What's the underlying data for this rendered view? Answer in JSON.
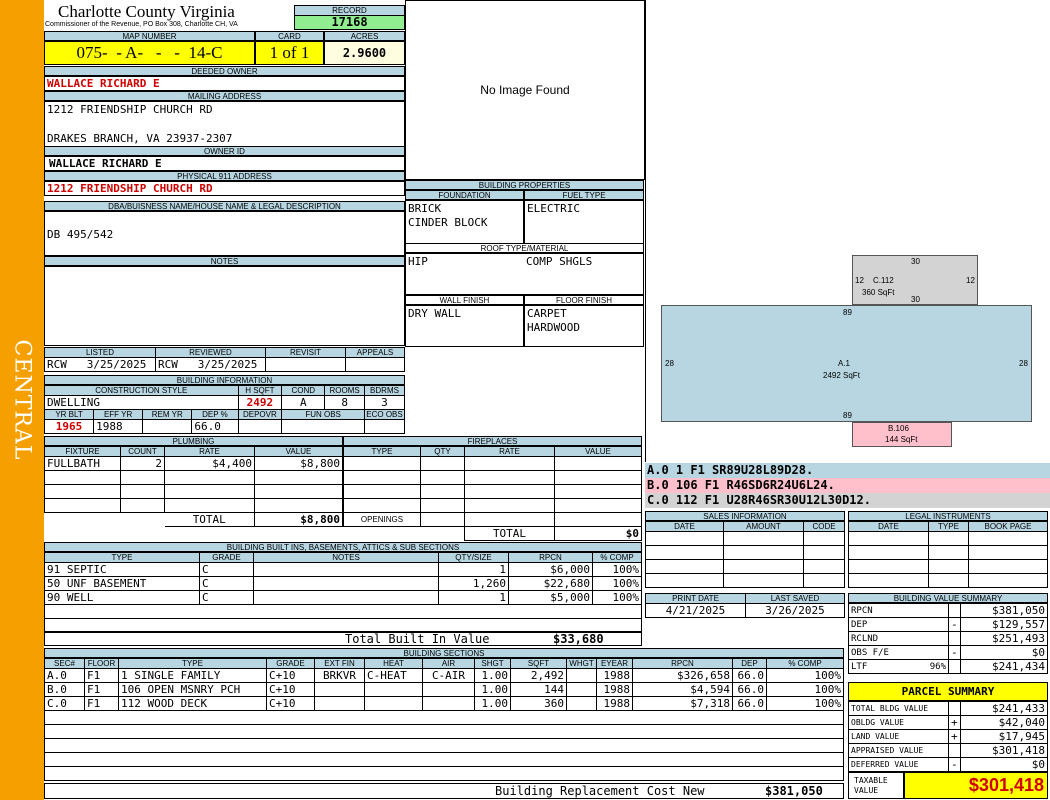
{
  "region": "CENTRAL",
  "county": {
    "title": "Charlotte County Virginia",
    "subtitle": "Commissioner of the Revenue, PO Box 308, Charlotte CH, VA"
  },
  "record": {
    "label": "RECORD",
    "value": "17168"
  },
  "map": {
    "label": "MAP NUMBER",
    "value": "075-  - A-   -   -  14-C"
  },
  "card": {
    "label": "CARD",
    "value": "1 of 1"
  },
  "acres": {
    "label": "ACRES",
    "value": "2.9600"
  },
  "deeded_owner": {
    "label": "DEEDED OWNER",
    "value": "WALLACE RICHARD E"
  },
  "mailing": {
    "label": "MAILING ADDRESS",
    "line1": "1212 FRIENDSHIP CHURCH RD",
    "line2": "DRAKES BRANCH, VA 23937-2307"
  },
  "owner_id": {
    "label": "OWNER ID",
    "value": "WALLACE RICHARD E"
  },
  "physical": {
    "label": "PHYSICAL 911 ADDRESS",
    "value": "1212 FRIENDSHIP CHURCH RD"
  },
  "dba": {
    "label": "DBA/BUISNESS NAME/HOUSE NAME & LEGAL DESCRIPTION",
    "value": "DB 495/542"
  },
  "notes": {
    "label": "NOTES"
  },
  "photo": {
    "text": "No Image Found"
  },
  "listed": {
    "label": "LISTED",
    "value": "RCW   3/25/2025"
  },
  "reviewed": {
    "label": "REVIEWED",
    "value": "RCW   3/25/2025"
  },
  "revisit": {
    "label": "REVISIT",
    "value": ""
  },
  "appeals": {
    "label": "APPEALS",
    "value": ""
  },
  "building_info": {
    "label": "BUILDING INFORMATION",
    "construction_label": "CONSTRUCTION STYLE",
    "hsqft_label": "H SQFT",
    "cond_label": "COND",
    "rooms_label": "ROOMS",
    "bdrms_label": "BDRMS",
    "construction": "DWELLING",
    "hsqft": "2492",
    "cond": "A",
    "rooms": "8",
    "bdrms": "3",
    "yrblt_label": "YR BLT",
    "effyr_label": "EFF YR",
    "remyr_label": "REM YR",
    "dep_label": "DEP %",
    "depovr_label": "DEPOVR",
    "funobs_label": "FUN OBS",
    "ecoobs_label": "ECO OBS",
    "yrblt": "1965",
    "effyr": "1988",
    "remyr": "",
    "dep": "66.0",
    "depovr": "",
    "funobs": "",
    "ecoobs": ""
  },
  "building_props": {
    "label": "BUILDING PROPERTIES",
    "foundation_label": "FOUNDATION",
    "fuel_label": "FUEL TYPE",
    "foundation1": "BRICK",
    "foundation2": "CINDER BLOCK",
    "fuel": "ELECTRIC",
    "roof_label": "ROOF TYPE/MATERIAL",
    "roof_type": "HIP",
    "roof_material": "COMP SHGLS",
    "wall_label": "WALL FINISH",
    "floor_label": "FLOOR FINISH",
    "wall": "DRY WALL",
    "floor1": "CARPET",
    "floor2": "HARDWOOD"
  },
  "sketch": {
    "a_label": "A.1",
    "a_area": "2492 SqFt",
    "a_top": "89",
    "a_bottom": "89",
    "a_left": "28",
    "a_right": "28",
    "b_label": "B.106",
    "b_area": "144 SqFt",
    "c_label": "C.112",
    "c_area": "360 SqFt",
    "c_top": "30",
    "c_bottom": "30",
    "c_left": "12",
    "c_right": "12"
  },
  "sketch_legend": [
    {
      "text": "A.0  1    F1  SR89U28L89D28.",
      "color": "#b7d6e2"
    },
    {
      "text": "B.0  106  F1  R46SD6R24U6L24.",
      "color": "#ffc0cb"
    },
    {
      "text": "C.0  112  F1  U28R46SR30U12L30D12.",
      "color": "#d3d3d3"
    }
  ],
  "plumbing": {
    "label": "PLUMBING",
    "headers": [
      "FIXTURE",
      "COUNT",
      "RATE",
      "VALUE"
    ],
    "rows": [
      [
        "FULLBATH",
        "2",
        "$4,400",
        "$8,800"
      ]
    ],
    "total_label": "TOTAL",
    "total": "$8,800"
  },
  "fireplaces": {
    "label": "FIREPLACES",
    "headers": [
      "TYPE",
      "QTY",
      "RATE",
      "VALUE"
    ],
    "openings_label": "OPENINGS",
    "total_label": "TOTAL",
    "total": "$0"
  },
  "builtins": {
    "label": "BUILDING BUILT INS, BASEMENTS, ATTICS & SUB SECTIONS",
    "headers": [
      "TYPE",
      "GRADE",
      "NOTES",
      "QTY/SIZE",
      "RPCN",
      "% COMP"
    ],
    "rows": [
      [
        "91 SEPTIC",
        "C",
        "",
        "1",
        "$6,000",
        "100%"
      ],
      [
        "50 UNF BASEMENT",
        "C",
        "",
        "1,260",
        "$22,680",
        "100%"
      ],
      [
        "90 WELL",
        "C",
        "",
        "1",
        "$5,000",
        "100%"
      ]
    ],
    "total_label": "Total Built In Value",
    "total": "$33,680"
  },
  "sales": {
    "label": "SALES INFORMATION",
    "headers": [
      "DATE",
      "AMOUNT",
      "CODE"
    ]
  },
  "legal": {
    "label": "LEGAL INSTRUMENTS",
    "headers": [
      "DATE",
      "TYPE",
      "BOOK PAGE"
    ]
  },
  "print_date": {
    "label": "PRINT DATE",
    "value": "4/21/2025"
  },
  "last_saved": {
    "label": "LAST SAVED",
    "value": "3/26/2025"
  },
  "bvs": {
    "label": "BUILDING VALUE SUMMARY",
    "rows": [
      {
        "label": "RPCN",
        "sign": "",
        "value": "$381,050"
      },
      {
        "label": "DEP",
        "sign": "-",
        "value": "$129,557"
      },
      {
        "label": "RCLND",
        "sign": "",
        "value": "$251,493"
      },
      {
        "label": "OBS F/E",
        "sign": "-",
        "value": "$0"
      },
      {
        "label": "LTF",
        "pct": "96%",
        "sign": "",
        "value": "$241,434"
      }
    ]
  },
  "parcel": {
    "label": "PARCEL SUMMARY",
    "rows": [
      {
        "label": "TOTAL BLDG VALUE",
        "sign": "",
        "value": "$241,433"
      },
      {
        "label": "OBLDG VALUE",
        "sign": "+",
        "value": "$42,040"
      },
      {
        "label": "LAND VALUE",
        "sign": "+",
        "value": "$17,945"
      },
      {
        "label": "APPRAISED VALUE",
        "sign": "",
        "value": "$301,418"
      },
      {
        "label": "DEFERRED VALUE",
        "sign": "-",
        "value": "$0"
      }
    ],
    "taxable_label1": "TAXABLE",
    "taxable_label2": "VALUE",
    "taxable": "$301,418"
  },
  "sections": {
    "label": "BUILDING SECTIONS",
    "headers": [
      "SEC#",
      "FLOOR",
      "TYPE",
      "GRADE",
      "EXT FIN",
      "HEAT",
      "AIR",
      "SHGT",
      "SQFT",
      "WHGT",
      "EYEAR",
      "RPCN",
      "DEP",
      "% COMP"
    ],
    "rows": [
      [
        "A.0",
        "F1",
        "1 SINGLE FAMILY",
        "C+10",
        "BRKVR",
        "C-HEAT",
        "C-AIR",
        "1.00",
        "2,492",
        "",
        "1988",
        "$326,658",
        "66.0",
        "100%"
      ],
      [
        "B.0",
        "F1",
        "106 OPEN MSNRY PCH",
        "C+10",
        "",
        "",
        "",
        "1.00",
        "144",
        "",
        "1988",
        "$4,594",
        "66.0",
        "100%"
      ],
      [
        "C.0",
        "F1",
        "112 WOOD DECK",
        "C+10",
        "",
        "",
        "",
        "1.00",
        "360",
        "",
        "1988",
        "$7,318",
        "66.0",
        "100%"
      ]
    ],
    "total_label": "Building Replacement Cost New",
    "total": "$381,050"
  },
  "colors": {
    "accent": "#f5a000",
    "header": "#b7d6e2",
    "yellow": "#ffff00",
    "green": "#90ee90",
    "red": "#d00000"
  }
}
